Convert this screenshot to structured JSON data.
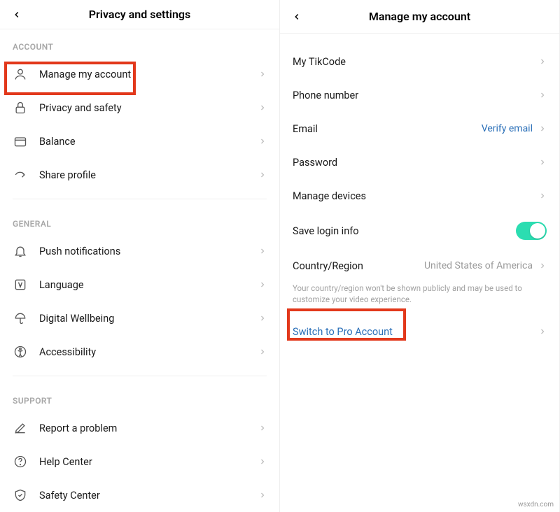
{
  "left": {
    "title": "Privacy and settings",
    "sections": {
      "account": {
        "label": "ACCOUNT",
        "items": [
          {
            "label": "Manage my account"
          },
          {
            "label": "Privacy and safety"
          },
          {
            "label": "Balance"
          },
          {
            "label": "Share profile"
          }
        ]
      },
      "general": {
        "label": "GENERAL",
        "items": [
          {
            "label": "Push notifications"
          },
          {
            "label": "Language"
          },
          {
            "label": "Digital Wellbeing"
          },
          {
            "label": "Accessibility"
          }
        ]
      },
      "support": {
        "label": "SUPPORT",
        "items": [
          {
            "label": "Report a problem"
          },
          {
            "label": "Help Center"
          },
          {
            "label": "Safety Center"
          }
        ]
      }
    }
  },
  "right": {
    "title": "Manage my account",
    "items": [
      {
        "label": "My TikCode"
      },
      {
        "label": "Phone number"
      },
      {
        "label": "Email",
        "value_link": "Verify email"
      },
      {
        "label": "Password"
      },
      {
        "label": "Manage devices"
      },
      {
        "label": "Save login info",
        "toggle": true
      },
      {
        "label": "Country/Region",
        "value": "United States of America"
      }
    ],
    "region_hint": "Your country/region won't be shown publicly and may be used to customize your video experience.",
    "switch_pro": "Switch to Pro Account"
  },
  "attribution": "wsxdn.com"
}
